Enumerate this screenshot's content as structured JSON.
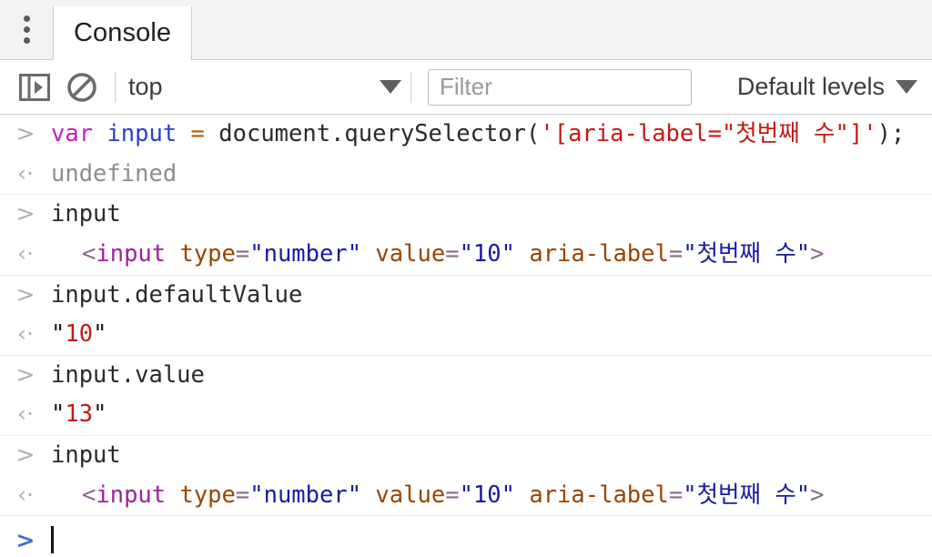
{
  "window": {
    "tab_label": "Console",
    "menu_icon": "more-vertical-icon"
  },
  "toolbar": {
    "sidebar_toggle_icon": "console-sidebar-toggle-icon",
    "clear_icon": "clear-console-icon",
    "context_selector": {
      "value": "top",
      "caret_icon": "chevron-down-icon"
    },
    "filter": {
      "value": "",
      "placeholder": "Filter"
    },
    "log_levels": {
      "label": "Default levels",
      "caret_icon": "chevron-down-icon"
    }
  },
  "console": {
    "input_marker": ">",
    "output_marker": "‹·",
    "groups": [
      {
        "command": {
          "kw": "var",
          "space1": " ",
          "ident": "input",
          "space2": " ",
          "op": "=",
          "space3": " ",
          "plain": "document.querySelector(",
          "string": "'[aria-label=\"첫번째 수\"]'",
          "tail": ");"
        },
        "result": {
          "kind": "undefined",
          "text": "undefined"
        }
      },
      {
        "command": {
          "plain": "input"
        },
        "result": {
          "kind": "element",
          "open": "<",
          "tag": "input",
          "attr1_name": " type",
          "attr1_eq": "=",
          "attr1_val": "\"number\"",
          "attr2_name": " value",
          "attr2_eq": "=",
          "attr2_val": "\"10\"",
          "attr3_name": " aria-label",
          "attr3_eq": "=",
          "attr3_val": "\"첫번째 수\"",
          "close": ">"
        }
      },
      {
        "command": {
          "plain": "input.defaultValue"
        },
        "result": {
          "kind": "string",
          "quote": "\"",
          "value": "10"
        }
      },
      {
        "command": {
          "plain": "input.value"
        },
        "result": {
          "kind": "string",
          "quote": "\"",
          "value": "13"
        }
      },
      {
        "command": {
          "plain": "input"
        },
        "result": {
          "kind": "element",
          "open": "<",
          "tag": "input",
          "attr1_name": " type",
          "attr1_eq": "=",
          "attr1_val": "\"number\"",
          "attr2_name": " value",
          "attr2_eq": "=",
          "attr2_val": "\"10\"",
          "attr3_name": " aria-label",
          "attr3_eq": "=",
          "attr3_val": "\"첫번째 수\"",
          "close": ">"
        }
      }
    ],
    "prompt": {
      "marker": ">",
      "value": ""
    }
  },
  "colors": {
    "keyword": "#c020c0",
    "identifier": "#2a3fd0",
    "operator": "#b85c00",
    "string": "#c41a16",
    "tag_name": "#a020a0",
    "attr_name": "#994500",
    "attr_value": "#1a1aa6",
    "undefined": "#8e8e8e",
    "prompt_active": "#3b6fd4"
  }
}
